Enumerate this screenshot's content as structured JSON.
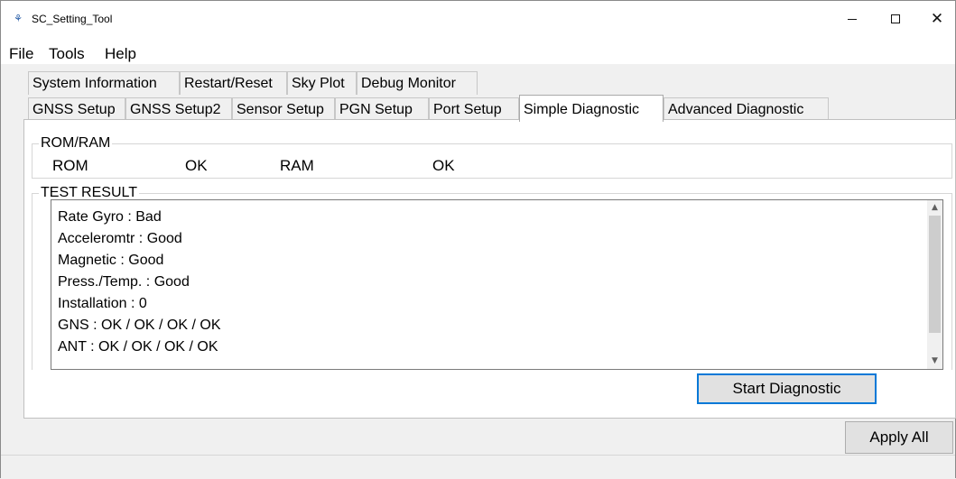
{
  "window": {
    "title": "SC_Setting_Tool"
  },
  "menu": [
    "File",
    "Tools",
    "Help"
  ],
  "tabs_row1": [
    "System Information",
    "Restart/Reset",
    "Sky Plot",
    "Debug Monitor"
  ],
  "tabs_row2": [
    "GNSS Setup",
    "GNSS Setup2",
    "Sensor Setup",
    "PGN Setup",
    "Port Setup",
    "Simple Diagnostic",
    "Advanced Diagnostic"
  ],
  "active_tab": "Simple Diagnostic",
  "romram": {
    "legend": "ROM/RAM",
    "rom_label": "ROM",
    "rom_value": "OK",
    "ram_label": "RAM",
    "ram_value": "OK"
  },
  "test_result": {
    "legend": "TEST RESULT",
    "lines": [
      "Rate Gyro : Bad",
      "Acceleromtr : Good",
      "Magnetic : Good",
      "Press./Temp. : Good",
      "Installation : 0",
      "GNS : OK / OK / OK / OK",
      "ANT : OK / OK / OK / OK"
    ]
  },
  "buttons": {
    "start_diagnostic": "Start Diagnostic",
    "apply_all": "Apply All"
  },
  "colors": {
    "focus_border": "#0078d7",
    "window_bg": "#f0f0f0"
  }
}
